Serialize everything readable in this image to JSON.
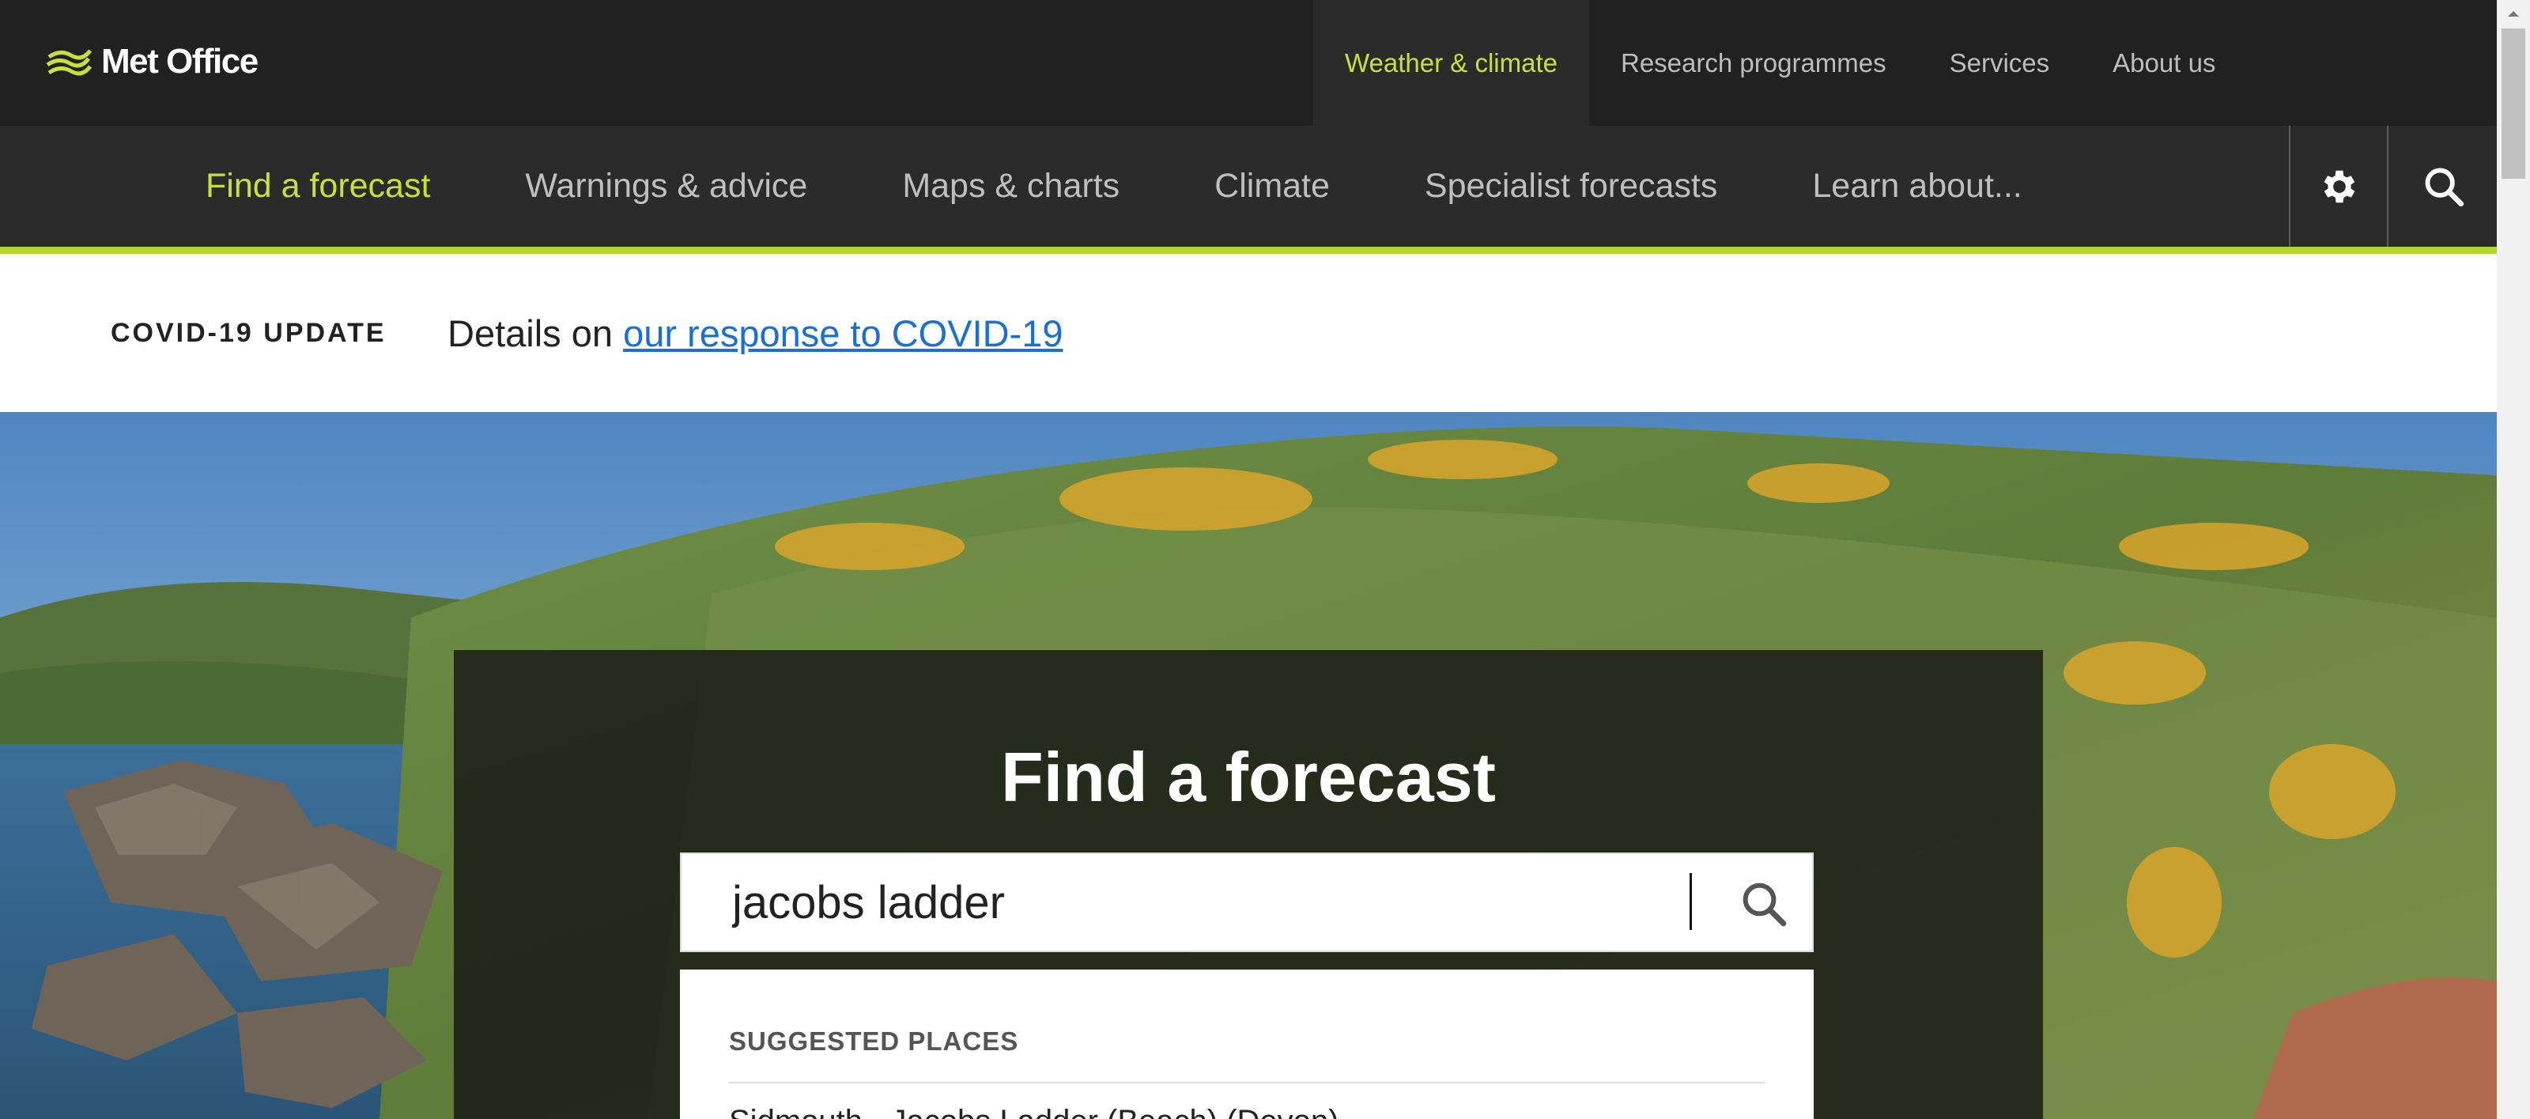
{
  "brand": {
    "name": "Met Office",
    "accent_color": "#c8e03c"
  },
  "top_nav": {
    "items": [
      {
        "label": "Weather & climate",
        "active": true
      },
      {
        "label": "Research programmes"
      },
      {
        "label": "Services"
      },
      {
        "label": "About us"
      }
    ]
  },
  "sub_nav": {
    "items": [
      {
        "label": "Find a forecast",
        "active": true
      },
      {
        "label": "Warnings & advice"
      },
      {
        "label": "Maps & charts"
      },
      {
        "label": "Climate"
      },
      {
        "label": "Specialist forecasts"
      },
      {
        "label": "Learn about..."
      }
    ],
    "icons": [
      "gear-icon",
      "search-icon"
    ]
  },
  "covid_banner": {
    "label": "COVID-19 UPDATE",
    "text": "Details on ",
    "link": "our response to COVID-19"
  },
  "hero": {
    "title": "Find a forecast",
    "search_value": "jacobs ladder",
    "suggestions_heading": "SUGGESTED PLACES",
    "suggestions": [
      "Sidmouth - Jacobs Ladder (Beach) (Devon)"
    ]
  }
}
